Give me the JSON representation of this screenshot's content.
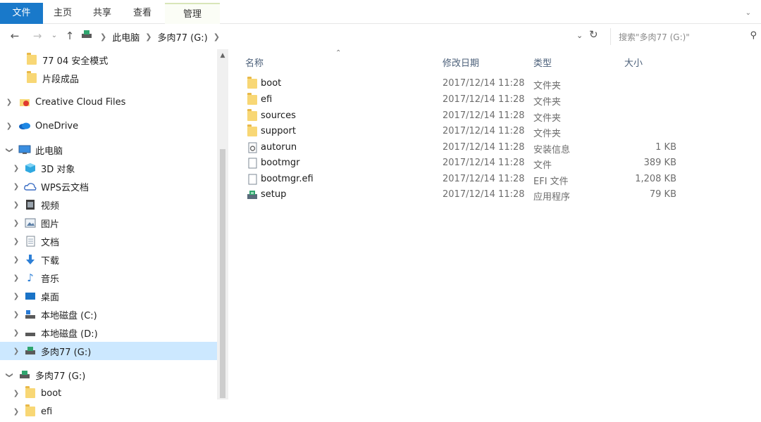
{
  "ribbon": {
    "tabs": [
      "文件",
      "主页",
      "共享",
      "查看",
      "管理"
    ]
  },
  "address": {
    "crumbs": [
      "此电脑",
      "多肉77 (G:)"
    ],
    "search_placeholder": "搜索\"多肉77 (G:)\""
  },
  "nav": {
    "items": [
      {
        "label": "77 04 安全模式",
        "icon": "folder-icon"
      },
      {
        "label": "片段成品",
        "icon": "folder-icon"
      },
      {
        "label": "Creative Cloud Files",
        "icon": "creative-cloud-icon"
      },
      {
        "label": "OneDrive",
        "icon": "cloud-icon"
      },
      {
        "label": "此电脑",
        "icon": "computer-icon"
      },
      {
        "label": "3D 对象",
        "icon": "cube-icon"
      },
      {
        "label": "WPS云文档",
        "icon": "cloud-icon"
      },
      {
        "label": "视频",
        "icon": "video-icon"
      },
      {
        "label": "图片",
        "icon": "picture-icon"
      },
      {
        "label": "文档",
        "icon": "document-icon"
      },
      {
        "label": "下载",
        "icon": "download-icon"
      },
      {
        "label": "音乐",
        "icon": "music-icon"
      },
      {
        "label": "桌面",
        "icon": "desktop-icon"
      },
      {
        "label": "本地磁盘 (C:)",
        "icon": "drive-icon"
      },
      {
        "label": "本地磁盘 (D:)",
        "icon": "drive-icon"
      },
      {
        "label": "多肉77 (G:)",
        "icon": "usb-drive-icon"
      },
      {
        "label": "多肉77 (G:)",
        "icon": "usb-drive-icon"
      },
      {
        "label": "boot",
        "icon": "folder-icon"
      },
      {
        "label": "efi",
        "icon": "folder-icon"
      }
    ]
  },
  "list": {
    "columns": {
      "name": "名称",
      "date": "修改日期",
      "type": "类型",
      "size": "大小"
    },
    "rows": [
      {
        "name": "boot",
        "date": "2017/12/14 11:28",
        "type": "文件夹",
        "size": "",
        "icon": "folder-icon"
      },
      {
        "name": "efi",
        "date": "2017/12/14 11:28",
        "type": "文件夹",
        "size": "",
        "icon": "folder-icon"
      },
      {
        "name": "sources",
        "date": "2017/12/14 11:28",
        "type": "文件夹",
        "size": "",
        "icon": "folder-icon"
      },
      {
        "name": "support",
        "date": "2017/12/14 11:28",
        "type": "文件夹",
        "size": "",
        "icon": "folder-icon"
      },
      {
        "name": "autorun",
        "date": "2017/12/14 11:28",
        "type": "安装信息",
        "size": "1 KB",
        "icon": "settings-file-icon"
      },
      {
        "name": "bootmgr",
        "date": "2017/12/14 11:28",
        "type": "文件",
        "size": "389 KB",
        "icon": "file-icon"
      },
      {
        "name": "bootmgr.efi",
        "date": "2017/12/14 11:28",
        "type": "EFI 文件",
        "size": "1,208 KB",
        "icon": "file-icon"
      },
      {
        "name": "setup",
        "date": "2017/12/14 11:28",
        "type": "应用程序",
        "size": "79 KB",
        "icon": "setup-app-icon"
      }
    ]
  },
  "colors": {
    "accent": "#1979ca",
    "selection": "#cce8ff",
    "folder": "#f8d775"
  }
}
